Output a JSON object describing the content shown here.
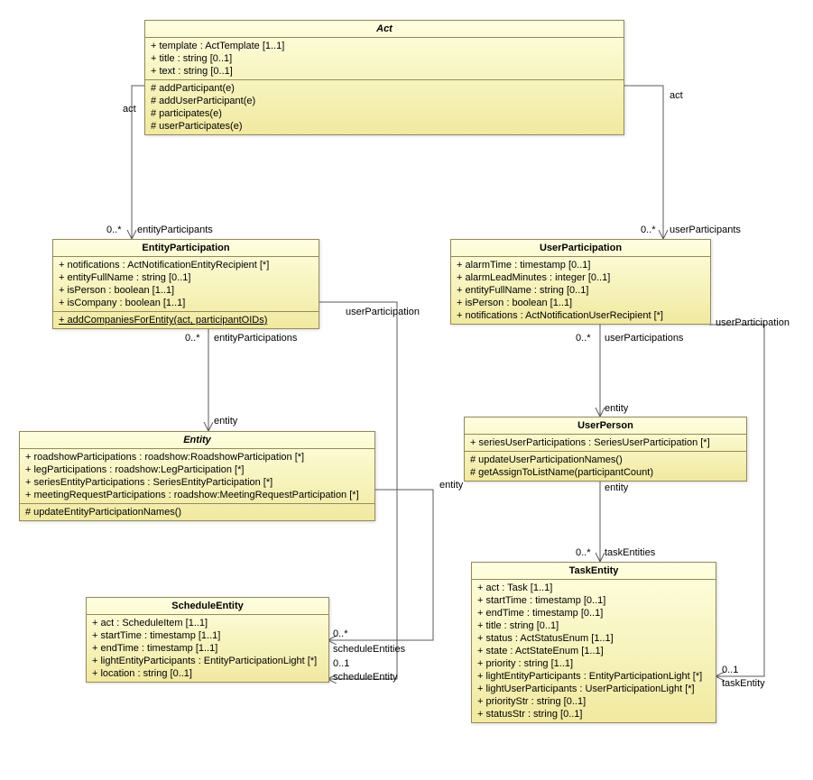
{
  "chart_data": {
    "type": "uml-class-diagram",
    "classes": [
      {
        "id": "Act",
        "name": "Act",
        "abstract": true,
        "attributes": [
          "+ template : ActTemplate [1..1]",
          "+ title : string [0..1]",
          "+ text : string [0..1]"
        ],
        "operations": [
          "# addParticipant(e)",
          "# addUserParticipant(e)",
          "# participates(e)",
          "# userParticipates(e)"
        ]
      },
      {
        "id": "EntityParticipation",
        "name": "EntityParticipation",
        "attributes": [
          "+ notifications : ActNotificationEntityRecipient [*]",
          "+ entityFullName : string [0..1]",
          "+ isPerson : boolean [1..1]",
          "+ isCompany : boolean [1..1]"
        ],
        "operations": [
          "+ addCompaniesForEntity(act, participantOIDs)"
        ],
        "static_ops": [
          "+ addCompaniesForEntity(act, participantOIDs)"
        ]
      },
      {
        "id": "UserParticipation",
        "name": "UserParticipation",
        "attributes": [
          "+ alarmTime : timestamp [0..1]",
          "+ alarmLeadMinutes : integer [0..1]",
          "+ entityFullName : string [0..1]",
          "+ isPerson : boolean [1..1]",
          "+ notifications : ActNotificationUserRecipient [*]"
        ],
        "operations": []
      },
      {
        "id": "Entity",
        "name": "Entity",
        "abstract": true,
        "attributes": [
          "+ roadshowParticipations : roadshow:RoadshowParticipation [*]",
          "+ legParticipations : roadshow:LegParticipation [*]",
          "+ seriesEntityParticipations : SeriesEntityParticipation [*]",
          "+ meetingRequestParticipations : roadshow:MeetingRequestParticipation [*]"
        ],
        "operations": [
          "# updateEntityParticipationNames()"
        ]
      },
      {
        "id": "UserPerson",
        "name": "UserPerson",
        "attributes": [
          "+ seriesUserParticipations : SeriesUserParticipation [*]"
        ],
        "operations": [
          "# updateUserParticipationNames()",
          "# getAssignToListName(participantCount)"
        ]
      },
      {
        "id": "ScheduleEntity",
        "name": "ScheduleEntity",
        "attributes": [
          "+ act : ScheduleItem [1..1]",
          "+ startTime : timestamp [1..1]",
          "+ endTime : timestamp [1..1]",
          "+ lightEntityParticipants : EntityParticipationLight [*]",
          "+ location : string [0..1]"
        ],
        "operations": []
      },
      {
        "id": "TaskEntity",
        "name": "TaskEntity",
        "attributes": [
          "+ act : Task [1..1]",
          "+ startTime : timestamp [0..1]",
          "+ endTime : timestamp [0..1]",
          "+ title : string [0..1]",
          "+ status : ActStatusEnum [1..1]",
          "+ state : ActStateEnum [1..1]",
          "+ priority : string [1..1]",
          "+ lightEntityParticipants : EntityParticipationLight [*]",
          "+ lightUserParticipants : UserParticipationLight [*]",
          "+ priorityStr : string [0..1]",
          "+ statusStr : string [0..1]"
        ],
        "operations": []
      }
    ],
    "associations": [
      {
        "from": "Act",
        "to": "EntityParticipation",
        "from_role": "act",
        "to_role": "entityParticipants",
        "to_mult": "0..*"
      },
      {
        "from": "Act",
        "to": "UserParticipation",
        "from_role": "act",
        "to_role": "userParticipants",
        "to_mult": "0..*"
      },
      {
        "from": "EntityParticipation",
        "to": "Entity",
        "from_role": "entityParticipations",
        "from_mult": "0..*",
        "to_role": "entity"
      },
      {
        "from": "UserParticipation",
        "to": "UserPerson",
        "from_role": "userParticipations",
        "from_mult": "0..*",
        "to_role": "entity"
      },
      {
        "from": "Entity",
        "to": "ScheduleEntity",
        "from_role": "entity",
        "to_role": "scheduleEntities",
        "to_mult": "0..*"
      },
      {
        "from": "EntityParticipation",
        "to": "ScheduleEntity",
        "from_role": "userParticipation",
        "to_role": "scheduleEntity",
        "to_mult": "0..1"
      },
      {
        "from": "UserPerson",
        "to": "TaskEntity",
        "from_role": "entity",
        "to_role": "taskEntities",
        "to_mult": "0..*"
      },
      {
        "from": "UserParticipation",
        "to": "TaskEntity",
        "from_role": "userParticipation",
        "to_role": "taskEntity",
        "to_mult": "0..1"
      }
    ]
  },
  "classes": {
    "Act": {
      "title": "Act",
      "attrs": [
        "+ template : ActTemplate [1..1]",
        "+ title : string [0..1]",
        "+ text : string [0..1]"
      ],
      "ops": [
        "# addParticipant(e)",
        "# addUserParticipant(e)",
        "# participates(e)",
        "# userParticipates(e)"
      ]
    },
    "EntityParticipation": {
      "title": "EntityParticipation",
      "attrs": [
        "+ notifications : ActNotificationEntityRecipient [*]",
        "+ entityFullName : string [0..1]",
        "+ isPerson : boolean [1..1]",
        "+ isCompany : boolean [1..1]"
      ],
      "ops": [
        "+ addCompaniesForEntity(act, participantOIDs)"
      ]
    },
    "UserParticipation": {
      "title": "UserParticipation",
      "attrs": [
        "+ alarmTime : timestamp [0..1]",
        "+ alarmLeadMinutes : integer [0..1]",
        "+ entityFullName : string [0..1]",
        "+ isPerson : boolean [1..1]",
        "+ notifications : ActNotificationUserRecipient [*]"
      ],
      "ops": []
    },
    "Entity": {
      "title": "Entity",
      "attrs": [
        "+ roadshowParticipations : roadshow:RoadshowParticipation [*]",
        "+ legParticipations : roadshow:LegParticipation [*]",
        "+ seriesEntityParticipations : SeriesEntityParticipation [*]",
        "+ meetingRequestParticipations : roadshow:MeetingRequestParticipation [*]"
      ],
      "ops": [
        "# updateEntityParticipationNames()"
      ]
    },
    "UserPerson": {
      "title": "UserPerson",
      "attrs": [
        "+ seriesUserParticipations : SeriesUserParticipation [*]"
      ],
      "ops": [
        "# updateUserParticipationNames()",
        "# getAssignToListName(participantCount)"
      ]
    },
    "ScheduleEntity": {
      "title": "ScheduleEntity",
      "attrs": [
        "+ act : ScheduleItem [1..1]",
        "+ startTime : timestamp [1..1]",
        "+ endTime : timestamp [1..1]",
        "+ lightEntityParticipants : EntityParticipationLight [*]",
        "+ location : string [0..1]"
      ],
      "ops": []
    },
    "TaskEntity": {
      "title": "TaskEntity",
      "attrs": [
        "+ act : Task [1..1]",
        "+ startTime : timestamp [0..1]",
        "+ endTime : timestamp [0..1]",
        "+ title : string [0..1]",
        "+ status : ActStatusEnum [1..1]",
        "+ state : ActStateEnum [1..1]",
        "+ priority : string [1..1]",
        "+ lightEntityParticipants : EntityParticipationLight [*]",
        "+ lightUserParticipants : UserParticipationLight [*]",
        "+ priorityStr : string [0..1]",
        "+ statusStr : string [0..1]"
      ],
      "ops": []
    }
  },
  "labels": {
    "act1": "act",
    "entityParticipants": "entityParticipants",
    "mult0star1": "0..*",
    "act2": "act",
    "userParticipants": "userParticipants",
    "mult0star2": "0..*",
    "entityParticipations": "entityParticipations",
    "mult0star3": "0..*",
    "entity1": "entity",
    "userParticipations": "userParticipations",
    "mult0star4": "0..*",
    "entity2": "entity",
    "userParticipation1": "userParticipation",
    "entity3": "entity",
    "scheduleEntities": "scheduleEntities",
    "mult0star5": "0..*",
    "scheduleEntity": "scheduleEntity",
    "mult01_1": "0..1",
    "entity4": "entity",
    "taskEntities": "taskEntities",
    "mult0star6": "0..*",
    "userParticipation2": "userParticipation",
    "taskEntity": "taskEntity",
    "mult01_2": "0..1"
  }
}
